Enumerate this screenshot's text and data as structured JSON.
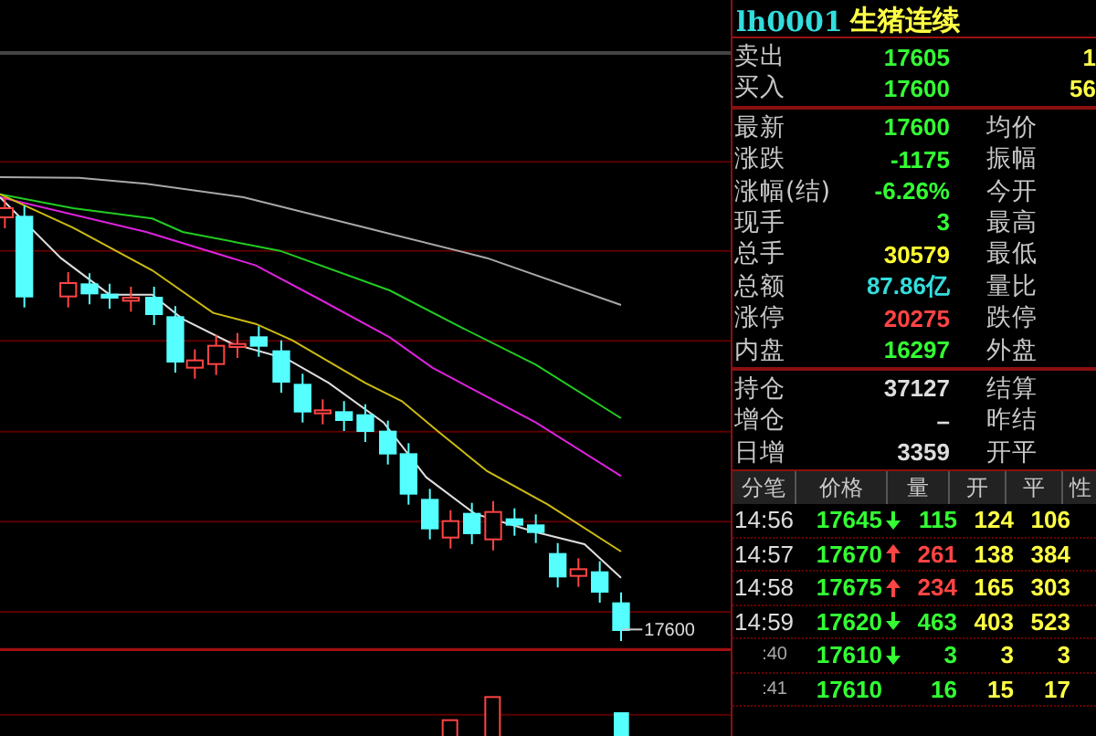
{
  "title": {
    "code": "lh0001",
    "name": "生猪连续"
  },
  "order_book": [
    {
      "label": "卖出",
      "price": "17605",
      "volume": "1"
    },
    {
      "label": "买入",
      "price": "17600",
      "volume": "56"
    }
  ],
  "quote": [
    {
      "label": "最新",
      "value": "17600",
      "color": "#33ff33",
      "label2": "均价"
    },
    {
      "label": "涨跌",
      "value": "-1175",
      "color": "#33ff33",
      "label2": "振幅"
    },
    {
      "label": "涨幅(结)",
      "value": "-6.26%",
      "color": "#33ff33",
      "label2": "今开"
    },
    {
      "label": "现手",
      "value": "3",
      "color": "#33ff33",
      "label2": "最高"
    },
    {
      "label": "总手",
      "value": "30579",
      "color": "#ffff33",
      "label2": "最低"
    },
    {
      "label": "总额",
      "value": "87.86亿",
      "color": "#33dddd",
      "label2": "量比"
    },
    {
      "label": "涨停",
      "value": "20275",
      "color": "#ff4444",
      "label2": "跌停"
    },
    {
      "label": "内盘",
      "value": "16297",
      "color": "#33ff33",
      "label2": "外盘"
    }
  ],
  "position": [
    {
      "label": "持仓",
      "value": "37127",
      "label2": "结算"
    },
    {
      "label": "增仓",
      "value": "–",
      "label2": "昨结"
    },
    {
      "label": "日增",
      "value": "3359",
      "label2": "开平"
    }
  ],
  "ticks": {
    "columns": [
      "分笔",
      "价格",
      "量",
      "开",
      "平",
      "性"
    ],
    "rows": [
      {
        "kind": "full",
        "time": "14:56",
        "price": "17645",
        "up_arrow": false,
        "down_arrow": true,
        "volume": "115",
        "open": "124",
        "close": "106"
      },
      {
        "kind": "full",
        "time": "14:57",
        "price": "17670",
        "up_arrow": true,
        "down_arrow": false,
        "volume": "261",
        "open": "138",
        "close": "384"
      },
      {
        "kind": "full",
        "time": "14:58",
        "price": "17675",
        "up_arrow": true,
        "down_arrow": false,
        "volume": "234",
        "open": "165",
        "close": "303"
      },
      {
        "kind": "full",
        "time": "14:59",
        "price": "17620",
        "up_arrow": false,
        "down_arrow": true,
        "volume": "463",
        "open": "403",
        "close": "523"
      },
      {
        "kind": "sub",
        "time": ":40",
        "price": "17610",
        "up_arrow": false,
        "down_arrow": true,
        "volume": "3",
        "open": "3",
        "close": "3"
      },
      {
        "kind": "sub",
        "time": ":41",
        "price": "17610",
        "up_arrow": false,
        "down_arrow": false,
        "volume": "16",
        "open": "15",
        "close": "17"
      }
    ]
  },
  "chart": {
    "last_price": "17600"
  }
}
